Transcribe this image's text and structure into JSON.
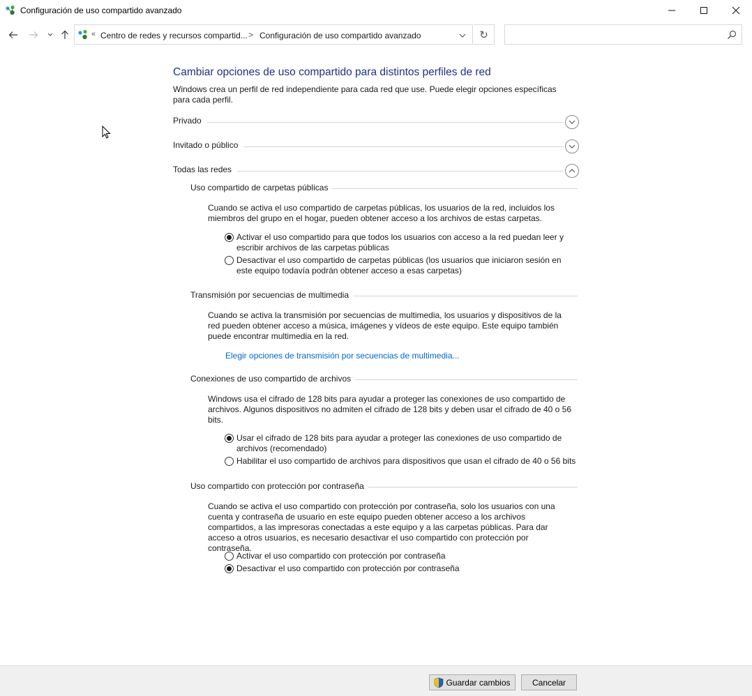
{
  "window": {
    "title": "Configuración de uso compartido avanzado",
    "icon": "network-sharing-icon"
  },
  "address": {
    "overflow": "«",
    "crumbs": [
      "Centro de redes y recursos compartid...",
      "Configuración de uso compartido avanzado"
    ],
    "separator": ">",
    "search_placeholder": ""
  },
  "page": {
    "title": "Cambiar opciones de uso compartido para distintos perfiles de red",
    "description": "Windows crea un perfil de red independiente para cada red que use. Puede elegir opciones específicas para cada perfil."
  },
  "profiles": [
    {
      "label": "Privado",
      "expanded": false
    },
    {
      "label": "Invitado o público",
      "expanded": false
    },
    {
      "label": "Todas las redes",
      "expanded": true
    }
  ],
  "sections": {
    "public_folders": {
      "title": "Uso compartido de carpetas públicas",
      "description": "Cuando se activa el uso compartido de carpetas públicas, los usuarios de la red, incluidos los miembros del grupo en el hogar, pueden obtener acceso a los archivos de estas carpetas.",
      "options": [
        {
          "label": "Activar el uso compartido para que todos los usuarios con acceso a la red puedan leer y escribir archivos de las carpetas públicas",
          "checked": true
        },
        {
          "label": "Desactivar el uso compartido de carpetas públicas (los usuarios que iniciaron sesión en este equipo todavía podrán obtener acceso a esas carpetas)",
          "checked": false
        }
      ]
    },
    "media_streaming": {
      "title": "Transmisión por secuencias de multimedia",
      "description": "Cuando se activa la transmisión por secuencias de multimedia, los usuarios y dispositivos de la red pueden obtener acceso a música, imágenes y vídeos de este equipo. Este equipo también puede encontrar multimedia en la red.",
      "link": "Elegir opciones de transmisión por secuencias de multimedia..."
    },
    "file_sharing": {
      "title": "Conexiones de uso compartido de archivos",
      "description": "Windows usa el cifrado de 128 bits para ayudar a proteger las conexiones de uso compartido de archivos. Algunos dispositivos no admiten el cifrado de 128 bits y deben usar el cifrado de 40 o 56 bits.",
      "options": [
        {
          "label": "Usar el cifrado de 128 bits para ayudar a proteger las conexiones de uso compartido de archivos (recomendado)",
          "checked": true
        },
        {
          "label": "Habilitar el uso compartido de archivos para dispositivos que usan el cifrado de 40 o 56 bits",
          "checked": false
        }
      ]
    },
    "password_sharing": {
      "title": "Uso compartido con protección por contraseña",
      "description": "Cuando se activa el uso compartido con protección por contraseña, solo los usuarios con una cuenta y contraseña de usuario en este equipo pueden obtener acceso a los archivos compartidos, a las impresoras conectadas a este equipo y a las carpetas públicas. Para dar acceso a otros usuarios, es necesario desactivar el uso compartido con protección por contraseña.",
      "options": [
        {
          "label": "Activar el uso compartido con protección por contraseña",
          "checked": false
        },
        {
          "label": "Desactivar el uso compartido con protección por contraseña",
          "checked": true
        }
      ]
    }
  },
  "footer": {
    "save_label": "Guardar cambios",
    "cancel_label": "Cancelar"
  },
  "colors": {
    "title_blue": "#1e3287",
    "link_blue": "#0066cc"
  }
}
